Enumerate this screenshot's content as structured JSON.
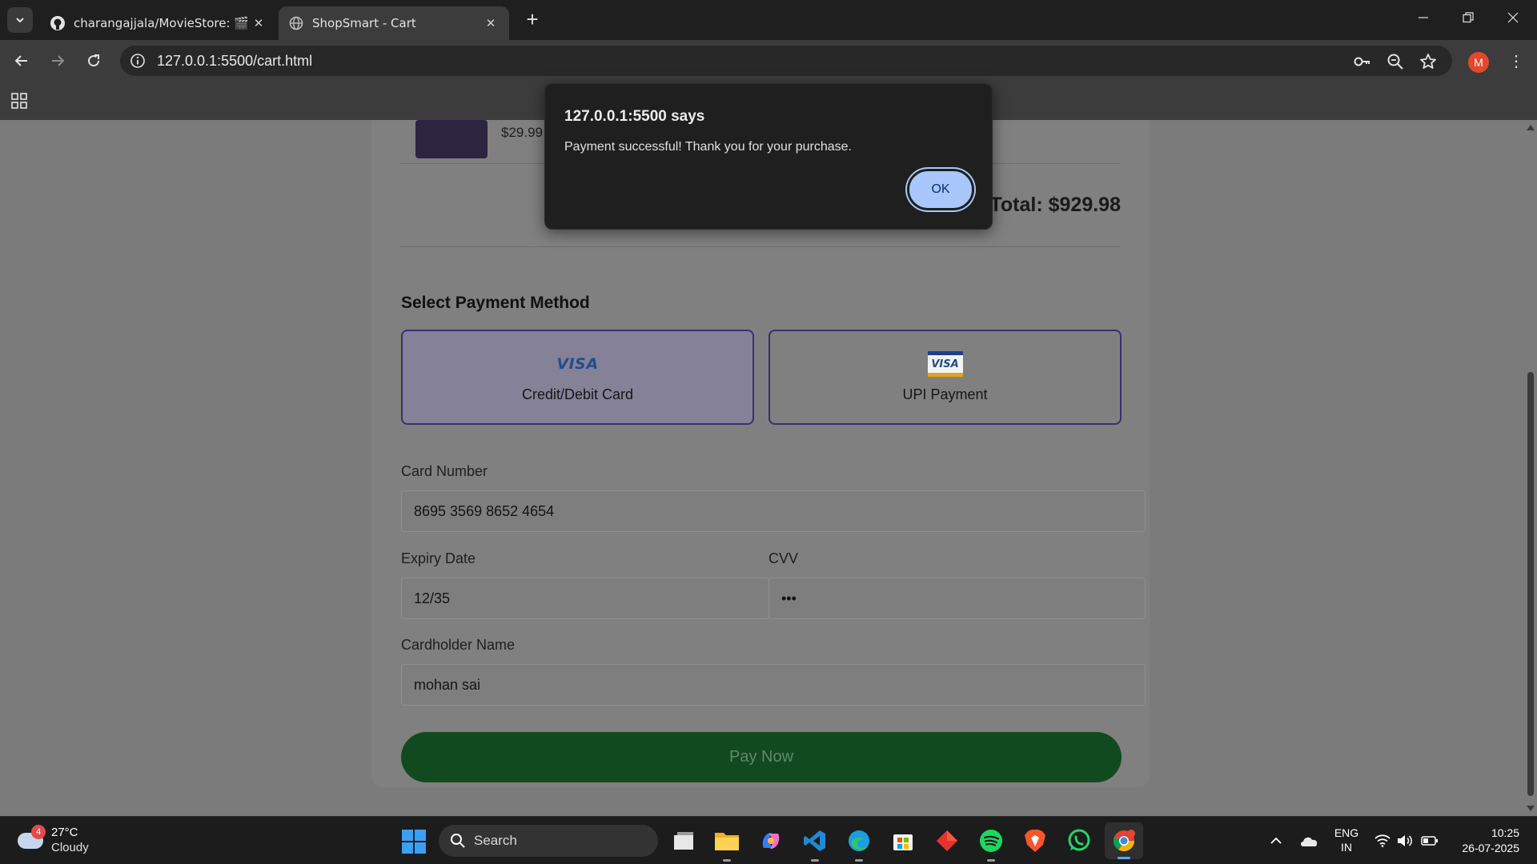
{
  "browser": {
    "tabs": [
      {
        "title": "charangajjala/MovieStore: 🎬🍿",
        "active": false
      },
      {
        "title": "ShopSmart - Cart",
        "active": true
      }
    ],
    "url": "127.0.0.1:5500/cart.html",
    "profile_initial": "M"
  },
  "cart": {
    "item_price": "$29.99",
    "total": "Total: $929.98"
  },
  "payment": {
    "title": "Select Payment Method",
    "options": [
      {
        "label": "Credit/Debit Card",
        "logo": "VISA",
        "selected": true
      },
      {
        "label": "UPI Payment",
        "logo": "VISA",
        "selected": false
      }
    ],
    "card_number_label": "Card Number",
    "card_number": "8695 3569 8652 4654",
    "expiry_label": "Expiry Date",
    "expiry": "12/35",
    "cvv_label": "CVV",
    "cvv": "•••",
    "cardholder_label": "Cardholder Name",
    "cardholder": "mohan sai",
    "pay_button": "Pay Now"
  },
  "dialog": {
    "title": "127.0.0.1:5500 says",
    "message": "Payment successful! Thank you for your purchase.",
    "ok_label": "OK"
  },
  "taskbar": {
    "weather_badge": "4",
    "temperature": "27°C",
    "condition": "Cloudy",
    "search_label": "Search",
    "lang_top": "ENG",
    "lang_bottom": "IN",
    "time": "10:25",
    "date": "26-07-2025"
  },
  "colors": {
    "accent_blue": "#a8c7fa",
    "pay_button": "#124a1f",
    "option_border": "#3c2f6e"
  }
}
